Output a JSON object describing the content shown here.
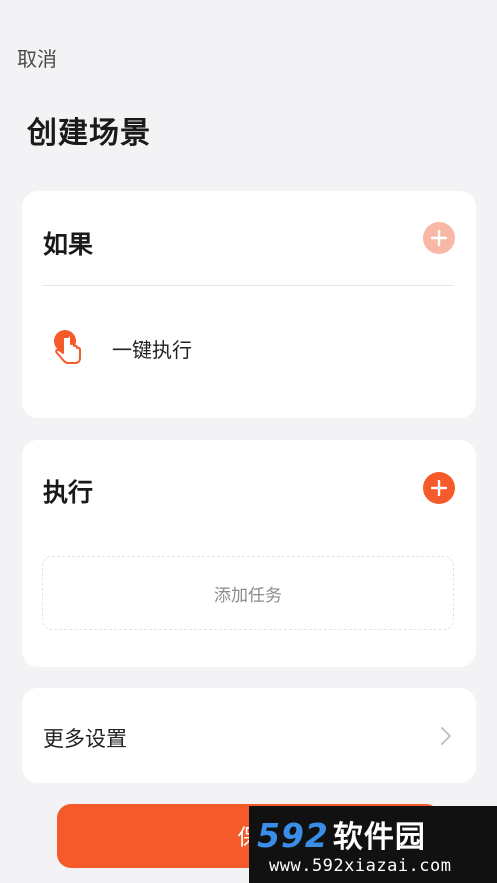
{
  "header": {
    "cancel_label": "取消",
    "title": "创建场景"
  },
  "if_card": {
    "heading": "如果",
    "add_icon": "plus-icon",
    "trigger": {
      "icon": "tap-hand-icon",
      "label": "一键执行"
    }
  },
  "execute_card": {
    "heading": "执行",
    "add_icon": "plus-icon",
    "add_task_label": "添加任务"
  },
  "more_card": {
    "label": "更多设置",
    "chevron_icon": "chevron-right-icon"
  },
  "save_button": {
    "label": "保"
  },
  "watermark": {
    "logo_digits": "592",
    "logo_text": "软件园",
    "url": "www.592xiazai.com"
  },
  "colors": {
    "accent": "#f45a2a",
    "accent_light": "#f9b8a6",
    "background": "#f3f3f6",
    "card": "#ffffff"
  }
}
